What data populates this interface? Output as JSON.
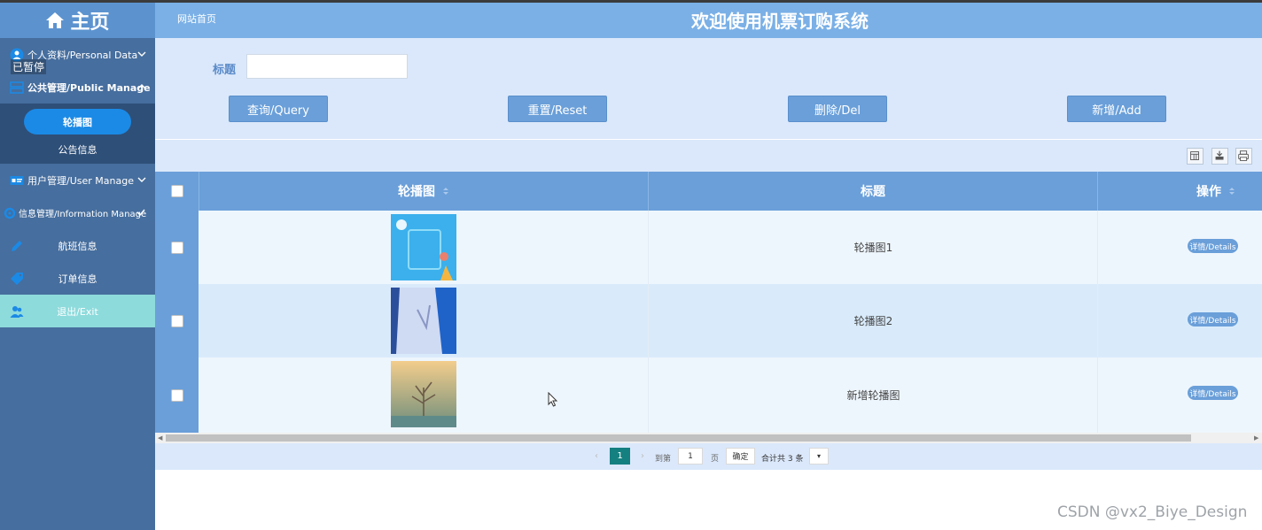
{
  "header": {
    "brand": "主页",
    "breadcrumb": "网站首页",
    "title": "欢迎使用机票订购系统"
  },
  "overlay": {
    "paused": "已暂停"
  },
  "sidebar": {
    "items": [
      {
        "label": "个人资料/Personal Data",
        "icon": "user-circle-icon",
        "expanded": false
      },
      {
        "label": "公共管理/Public Manage",
        "icon": "server-icon",
        "expanded": true,
        "children": [
          {
            "label": "轮播图",
            "active": true
          },
          {
            "label": "公告信息",
            "active": false
          }
        ]
      },
      {
        "label": "用户管理/User Manage",
        "icon": "id-card-icon",
        "expanded": false
      },
      {
        "label": "信息管理/Information Manage",
        "icon": "gear-icon",
        "expanded": true
      },
      {
        "label": "航班信息",
        "icon": "pencil-icon"
      },
      {
        "label": "订单信息",
        "icon": "tag-icon"
      },
      {
        "label": "退出/Exit",
        "icon": "users-icon"
      }
    ]
  },
  "search": {
    "label": "标题",
    "value": "",
    "placeholder": ""
  },
  "actions": {
    "query": "查询/Query",
    "reset": "重置/Reset",
    "delete": "删除/Del",
    "add": "新增/Add"
  },
  "toolbar_icons": [
    "columns-icon",
    "export-icon",
    "print-icon"
  ],
  "table": {
    "columns": [
      "轮播图",
      "标题",
      "操作"
    ],
    "rows": [
      {
        "image": "轮播图 1",
        "title": "轮播图1",
        "action": "详情/Details",
        "colors": [
          "#5ec3ee",
          "#2e9be0"
        ]
      },
      {
        "image": "轮播图 2",
        "title": "轮播图2",
        "action": "详情/Details",
        "colors": [
          "#c9d6f2",
          "#1f5fc4"
        ]
      },
      {
        "image": "新增轮播图",
        "title": "新增轮播图",
        "action": "详情/Details",
        "colors": [
          "#f0c784",
          "#6a8a78"
        ]
      }
    ]
  },
  "pagination": {
    "prev": "‹",
    "current": "1",
    "next": "›",
    "goto_label": "到第",
    "goto_value": "1",
    "page_unit": "页",
    "confirm": "确定",
    "total": "合计共 3 条",
    "page_size_caret": "▾"
  },
  "watermark": "CSDN @vx2_Biye_Design",
  "colors": {
    "header": "#7ab0e6",
    "sidebar": "#466e9e",
    "accent": "#6a9fd9",
    "active_pill": "#1b8ae6",
    "exit_bg": "#8edbdc",
    "pager_active": "#158080"
  }
}
